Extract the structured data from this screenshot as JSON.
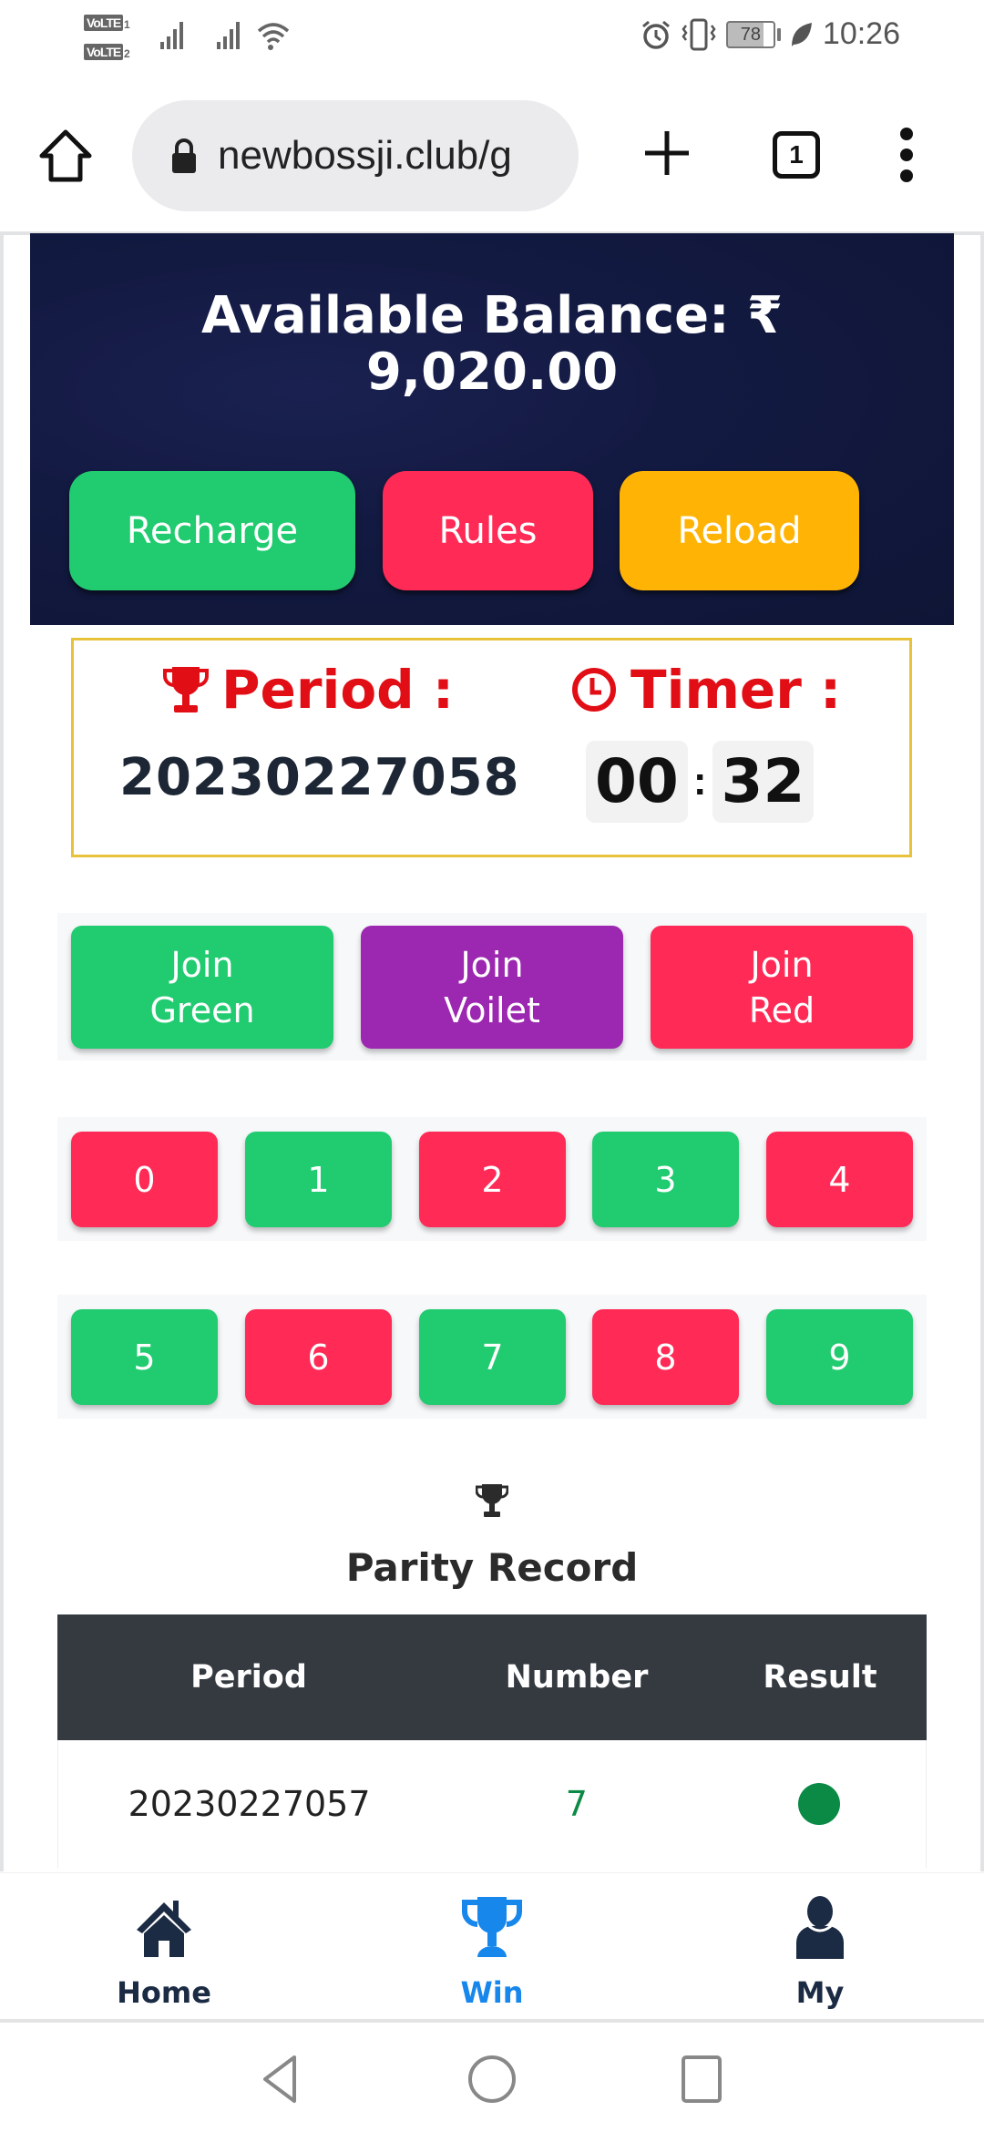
{
  "status_bar": {
    "sim1_label": "VoLTE",
    "sim1_index": "1",
    "sim2_label": "VoLTE",
    "sim2_index": "2",
    "battery_percent": "78",
    "time": "10:26",
    "icons": [
      "signal-icon",
      "signal-icon",
      "wifi-icon",
      "alarm-icon",
      "vibrate-icon",
      "battery-icon",
      "leaf-icon"
    ]
  },
  "browser": {
    "url": "newbossji.club/g",
    "tab_count": "1",
    "icons": [
      "home-icon",
      "lock-icon",
      "plus-icon",
      "tabs-icon",
      "more-menu-icon"
    ]
  },
  "balance": {
    "title": "Available Balance: ₹",
    "amount": "9,020.00",
    "buttons": {
      "recharge": "Recharge",
      "rules": "Rules",
      "reload": "Reload"
    }
  },
  "game": {
    "period_label": "Period :",
    "timer_label": "Timer :",
    "period_value": "20230227058",
    "timer_minutes": "00",
    "timer_separator": ":",
    "timer_seconds": "32"
  },
  "join": {
    "green": {
      "line1": "Join",
      "line2": "Green"
    },
    "violet": {
      "line1": "Join",
      "line2": "Voilet"
    },
    "red": {
      "line1": "Join",
      "line2": "Red"
    }
  },
  "numbers": [
    {
      "label": "0",
      "color": "red"
    },
    {
      "label": "1",
      "color": "green"
    },
    {
      "label": "2",
      "color": "red"
    },
    {
      "label": "3",
      "color": "green"
    },
    {
      "label": "4",
      "color": "red"
    },
    {
      "label": "5",
      "color": "green"
    },
    {
      "label": "6",
      "color": "red"
    },
    {
      "label": "7",
      "color": "green"
    },
    {
      "label": "8",
      "color": "red"
    },
    {
      "label": "9",
      "color": "green"
    }
  ],
  "record": {
    "title": "Parity Record",
    "columns": [
      "Period",
      "Number",
      "Result"
    ],
    "rows": [
      {
        "period": "20230227057",
        "number": "7",
        "result_color": "#0b8a45"
      }
    ]
  },
  "bottom_nav": {
    "items": [
      {
        "label": "Home",
        "icon": "home-icon",
        "active": false
      },
      {
        "label": "Win",
        "icon": "trophy-icon",
        "active": true
      },
      {
        "label": "My",
        "icon": "user-icon",
        "active": false
      }
    ],
    "active_color": "#1787ec"
  },
  "colors": {
    "green": "#21cb70",
    "red": "#ff2a55",
    "violet": "#9c27b0",
    "yellow": "#ffb405",
    "period_red": "#e20e16",
    "table_header": "#343a40"
  }
}
